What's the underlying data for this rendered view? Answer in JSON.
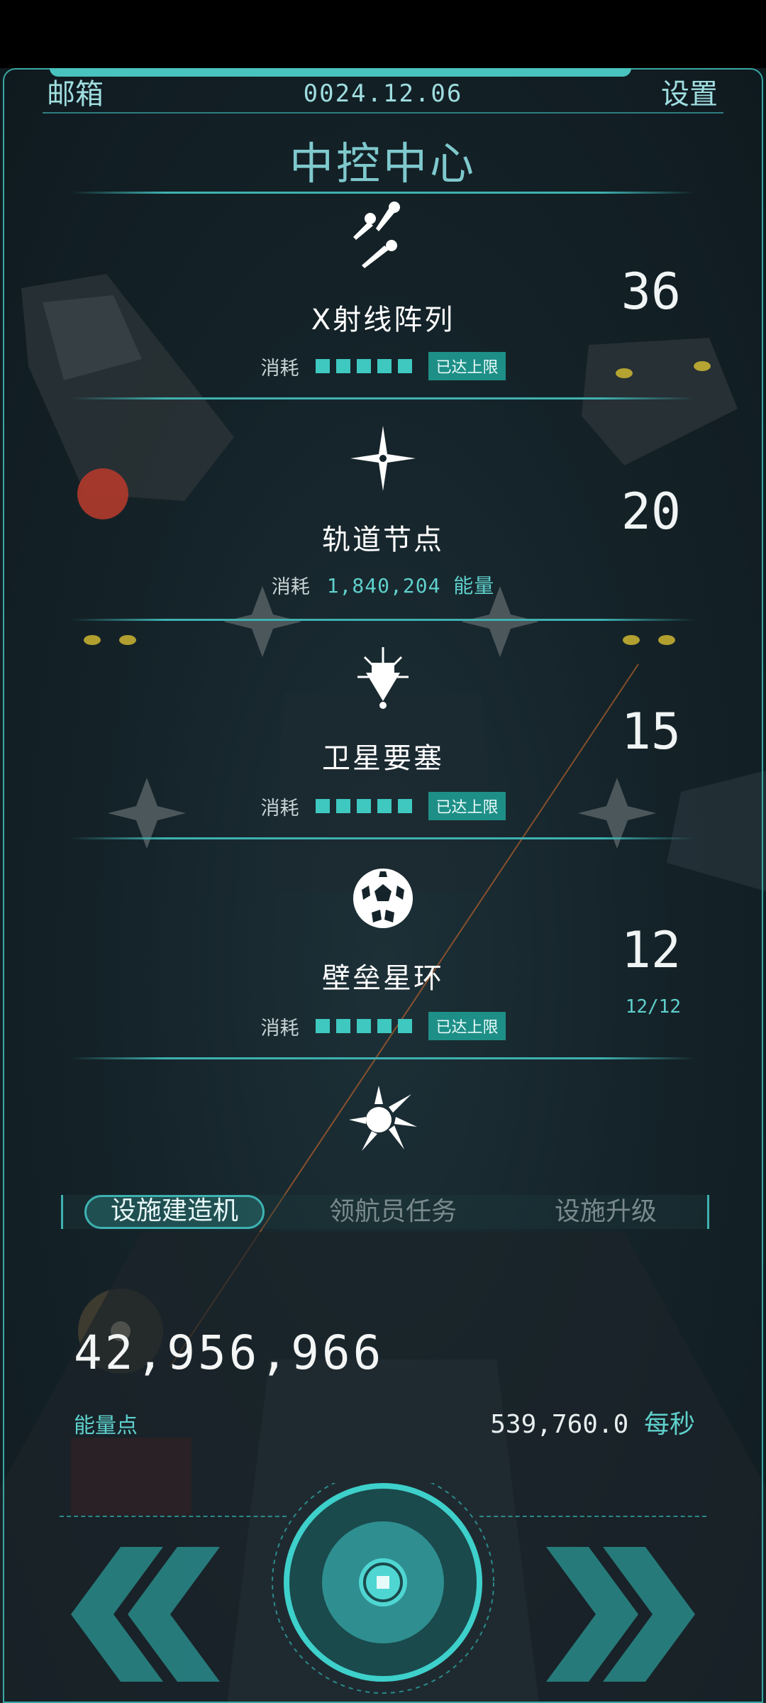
{
  "header": {
    "mail_label": "邮箱",
    "date": "0024.12.06",
    "settings_label": "设置",
    "title": "中控中心"
  },
  "items": [
    {
      "name": "X射线阵列",
      "count": "36",
      "cost_label": "消耗",
      "cost_blocks": 5,
      "status": "已达上限",
      "icon": "missiles-icon"
    },
    {
      "name": "轨道节点",
      "count": "20",
      "cost_label": "消耗",
      "cost_value": "1,840,204 能量",
      "icon": "star-icon"
    },
    {
      "name": "卫星要塞",
      "count": "15",
      "cost_label": "消耗",
      "cost_blocks": 5,
      "status": "已达上限",
      "icon": "satellite-icon"
    },
    {
      "name": "壁垒星环",
      "count": "12",
      "sub_count": "12/12",
      "cost_label": "消耗",
      "cost_blocks": 5,
      "status": "已达上限",
      "icon": "sphere-icon"
    },
    {
      "icon": "burst-icon"
    }
  ],
  "tabs": [
    {
      "label": "设施建造机",
      "active": true
    },
    {
      "label": "领航员任务",
      "active": false
    },
    {
      "label": "设施升级",
      "active": false
    }
  ],
  "energy": {
    "value": "42,956,966",
    "label": "能量点",
    "rate": "539,760.0",
    "rate_unit": "每秒"
  },
  "colors": {
    "accent": "#3eb1b1",
    "background": "#15242a",
    "text": "#dfe8ea"
  }
}
